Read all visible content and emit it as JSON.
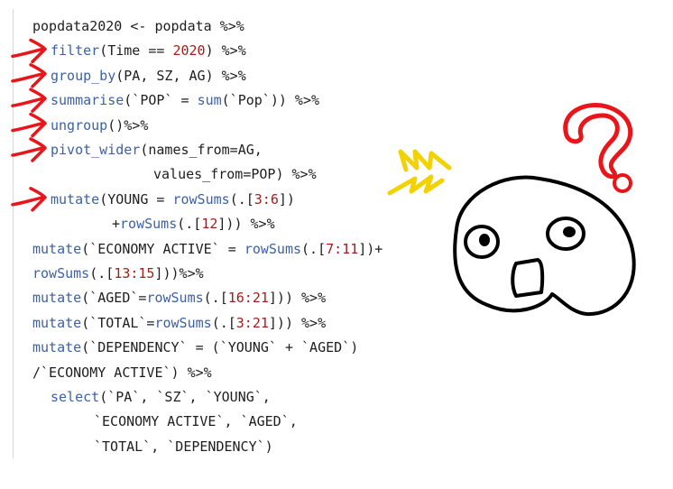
{
  "code": {
    "lines": [
      {
        "indent": 36,
        "tokens": [
          {
            "t": "popdata2020 <- popdata %>%",
            "c": "plain"
          }
        ]
      },
      {
        "indent": 56,
        "tokens": [
          {
            "t": "filter",
            "c": "fn"
          },
          {
            "t": "(Time == ",
            "c": "plain"
          },
          {
            "t": "2020",
            "c": "num"
          },
          {
            "t": ") %>%",
            "c": "plain"
          }
        ]
      },
      {
        "indent": 56,
        "tokens": [
          {
            "t": "group_by",
            "c": "fn"
          },
          {
            "t": "(PA, SZ, AG) %>%",
            "c": "plain"
          }
        ]
      },
      {
        "indent": 56,
        "tokens": [
          {
            "t": "summarise",
            "c": "fn"
          },
          {
            "t": "(`POP` = ",
            "c": "plain"
          },
          {
            "t": "sum",
            "c": "fn"
          },
          {
            "t": "(`Pop`)) %>%",
            "c": "plain"
          }
        ]
      },
      {
        "indent": 56,
        "tokens": [
          {
            "t": "ungroup",
            "c": "fn"
          },
          {
            "t": "()%>%",
            "c": "plain"
          }
        ]
      },
      {
        "indent": 56,
        "tokens": [
          {
            "t": "pivot_wider",
            "c": "fn"
          },
          {
            "t": "(names_from=AG,",
            "c": "plain"
          }
        ]
      },
      {
        "indent": 170,
        "tokens": [
          {
            "t": "values_from=POP) %>%",
            "c": "plain"
          }
        ]
      },
      {
        "indent": 56,
        "tokens": [
          {
            "t": "mutate",
            "c": "fn"
          },
          {
            "t": "(YOUNG = ",
            "c": "plain"
          },
          {
            "t": "rowSums",
            "c": "fn"
          },
          {
            "t": "(.[",
            "c": "plain"
          },
          {
            "t": "3:6",
            "c": "num"
          },
          {
            "t": "])",
            "c": "plain"
          }
        ]
      },
      {
        "indent": 124,
        "tokens": [
          {
            "t": "+",
            "c": "plain"
          },
          {
            "t": "rowSums",
            "c": "fn"
          },
          {
            "t": "(.[",
            "c": "plain"
          },
          {
            "t": "12",
            "c": "num"
          },
          {
            "t": "])) %>%",
            "c": "plain"
          }
        ]
      },
      {
        "indent": 36,
        "tokens": [
          {
            "t": "mutate",
            "c": "fn"
          },
          {
            "t": "(`ECONOMY ACTIVE` = ",
            "c": "plain"
          },
          {
            "t": "rowSums",
            "c": "fn"
          },
          {
            "t": "(.[",
            "c": "plain"
          },
          {
            "t": "7:11",
            "c": "num"
          },
          {
            "t": "])+",
            "c": "plain"
          }
        ]
      },
      {
        "indent": 36,
        "tokens": [
          {
            "t": "rowSums",
            "c": "fn"
          },
          {
            "t": "(.[",
            "c": "plain"
          },
          {
            "t": "13:15",
            "c": "num"
          },
          {
            "t": "]))%>%",
            "c": "plain"
          }
        ]
      },
      {
        "indent": 36,
        "tokens": [
          {
            "t": "mutate",
            "c": "fn"
          },
          {
            "t": "(`AGED`=",
            "c": "plain"
          },
          {
            "t": "rowSums",
            "c": "fn"
          },
          {
            "t": "(.[",
            "c": "plain"
          },
          {
            "t": "16:21",
            "c": "num"
          },
          {
            "t": "])) %>%",
            "c": "plain"
          }
        ]
      },
      {
        "indent": 36,
        "tokens": [
          {
            "t": "mutate",
            "c": "fn"
          },
          {
            "t": "(`TOTAL`=",
            "c": "plain"
          },
          {
            "t": "rowSums",
            "c": "fn"
          },
          {
            "t": "(.[",
            "c": "plain"
          },
          {
            "t": "3:21",
            "c": "num"
          },
          {
            "t": "])) %>%",
            "c": "plain"
          }
        ]
      },
      {
        "indent": 36,
        "tokens": [
          {
            "t": "mutate",
            "c": "fn"
          },
          {
            "t": "(`DEPENDENCY` = (`YOUNG` + `AGED`)",
            "c": "plain"
          }
        ]
      },
      {
        "indent": 36,
        "tokens": [
          {
            "t": "/`ECONOMY ACTIVE`) %>%",
            "c": "plain"
          }
        ]
      },
      {
        "indent": 56,
        "tokens": [
          {
            "t": "select",
            "c": "fn"
          },
          {
            "t": "(`PA`, `SZ`, `YOUNG`,",
            "c": "plain"
          }
        ]
      },
      {
        "indent": 104,
        "tokens": [
          {
            "t": "`ECONOMY ACTIVE`, `AGED`,",
            "c": "plain"
          }
        ]
      },
      {
        "indent": 104,
        "tokens": [
          {
            "t": "`TOTAL`, `DEPENDENCY`)",
            "c": "plain"
          }
        ]
      }
    ]
  },
  "colors": {
    "function": "#3d61a4",
    "number": "#a21d1d",
    "plain": "#1e1e1e",
    "arrow": "#e8161a",
    "question": "#e8161a",
    "zigzag": "#f2d200",
    "face": "#000000"
  },
  "annotations": {
    "arrows_on_lines": [
      1,
      2,
      3,
      4,
      5,
      7
    ],
    "doodle": "confused-face-icon",
    "question": "question-mark-icon",
    "shock": "shock-zigzag-icon"
  }
}
